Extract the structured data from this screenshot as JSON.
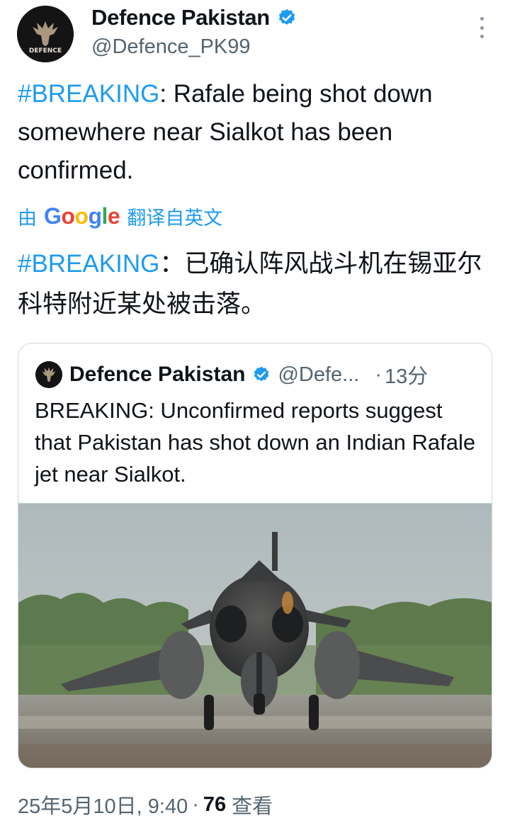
{
  "author": {
    "name": "Defence Pakistan",
    "handle": "@Defence_PK99",
    "avatar_text": "DEFENCE",
    "verified_icon": "verified-badge-icon",
    "verified_color": "#1d9bf0"
  },
  "tweet": {
    "hashtag": "#BREAKING",
    "text": ": Rafale being shot down somewhere near Sialkot has been confirmed.",
    "translate_prefix": "由",
    "translate_brand": "Google",
    "translate_suffix": "翻译自英文",
    "translated_hashtag": "#BREAKING",
    "translated_text": "：已确认阵风战斗机在锡亚尔科特附近某处被击落。"
  },
  "quote": {
    "name": "Defence Pakistan",
    "handle": "@Defe...",
    "separator": "·",
    "time": "13分",
    "text": "BREAKING: Unconfirmed reports suggest that Pakistan has shot down an Indian Rafale jet near Sialkot.",
    "media_icon": "fighter-jet-photo"
  },
  "footer": {
    "date_time": "25年5月10日, 9:40",
    "separator": "·",
    "views_count": "76",
    "views_label": "查看"
  },
  "colors": {
    "accent": "#1d9bf0",
    "text": "#0f1419",
    "secondary": "#536471",
    "border": "#cfd9de"
  }
}
